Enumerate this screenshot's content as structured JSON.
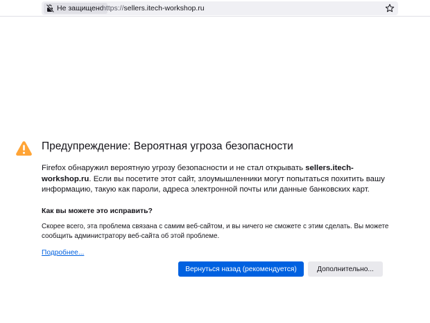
{
  "browser": {
    "identity_label": "Не защищено",
    "url_scheme": "https://",
    "url_host": "sellers.itech-workshop.ru",
    "icons": {
      "identity": "broken-lock-icon",
      "bookmark": "star-icon"
    }
  },
  "error": {
    "title": "Предупреждение: Вероятная угроза безопасности",
    "desc_prefix": "Firefox обнаружил вероятную угрозу безопасности и не стал открывать ",
    "desc_host": "sellers.itech-workshop.ru",
    "desc_suffix": ". Если вы посетите этот сайт, злоумышленники могут попытаться похитить вашу информацию, такую как пароли, адреса электронной почты или данные банковских карт.",
    "fix_title": "Как вы можете это исправить?",
    "fix_text": "Скорее всего, эта проблема связана с самим веб-сайтом, и вы ничего не сможете с этим сделать. Вы можете сообщить администратору веб-сайта об этой проблеме.",
    "learn_more": "Подробнее...",
    "go_back_button": "Вернуться назад (рекомендуется)",
    "advanced_button": "Дополнительно...",
    "icon": "warning-icon"
  },
  "colors": {
    "accent": "#0061e0",
    "warning": "#ffa436",
    "text": "#15141a"
  }
}
